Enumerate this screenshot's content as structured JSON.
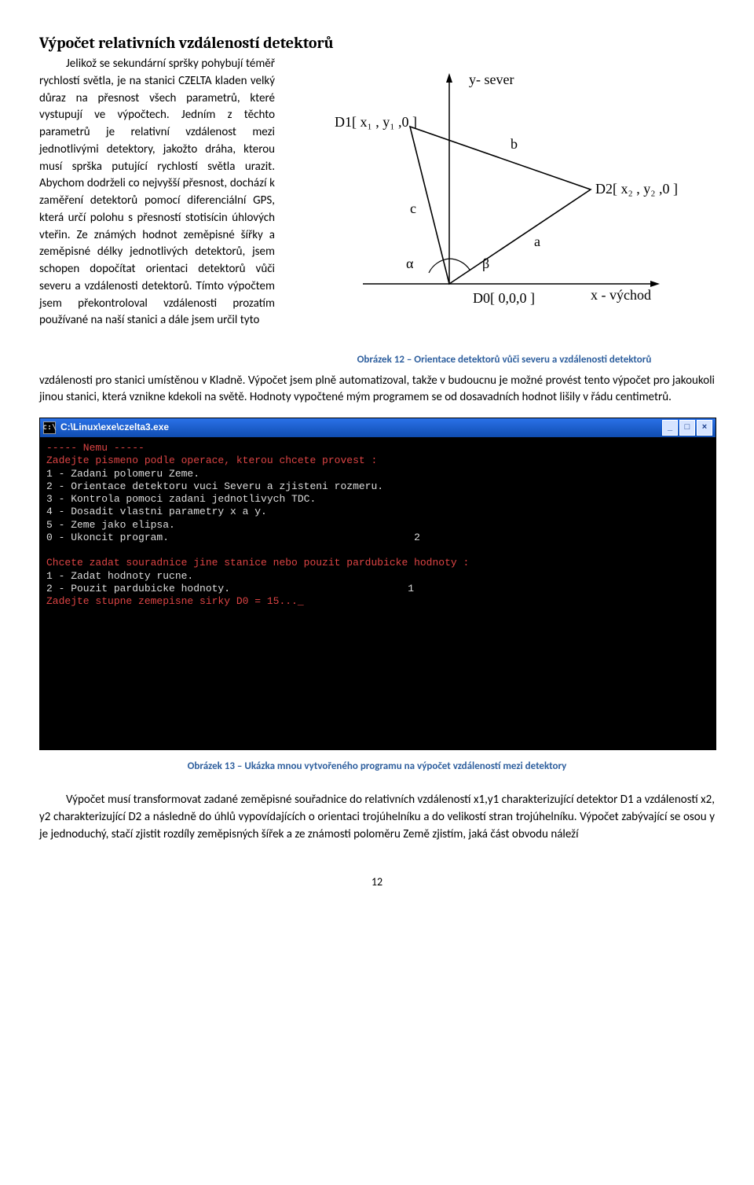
{
  "heading": "Výpočet relativních vzdáleností detektorů",
  "intro": "Jelikož se sekundární spršky pohybují téměř rychlostí světla, je na stanici CZELTA kladen velký důraz na přesnost všech parametrů, které vystupují ve výpočtech. Jedním z těchto parametrů je relativní vzdálenost mezi jednotlivými detektory, jakožto dráha, kterou musí sprška putující rychlostí světla urazit. Abychom dodrželi co nejvyšší přesnost, dochází k zaměření detektorů pomocí diferenciální GPS, která určí polohu s přesností stotisícin úhlových vteřin. Ze známých hodnot zeměpisné šířky a zeměpisné délky jednotlivých detektorů, jsem schopen dopočítat orientaci detektorů vůči severu a vzdálenosti detektorů. Tímto výpočtem jsem překontroloval vzdálenosti prozatím používané na naší stanici a dále jsem určil tyto",
  "after": "vzdálenosti pro stanici umístěnou v Kladně. Výpočet jsem plně automatizoval, takže v budoucnu je možné provést tento výpočet pro jakoukoli jinou stanici, která vznikne kdekoli na světě. Hodnoty vypočtené mým programem se od dosavadních hodnot lišily v řádu centimetrů.",
  "figure": {
    "ylabel": "y- sever",
    "xlabel": "x - východ",
    "D1": "D1[ x₁ , y₁ ,0 ]",
    "D2": "D2[ x₂ , y₂ ,0 ]",
    "D0": "D0[ 0,0,0 ]",
    "a": "a",
    "b": "b",
    "c": "c",
    "alpha": "α",
    "beta": "β",
    "caption": "Obrázek 12 – Orientace detektorů vůči severu a vzdálenosti detektorů"
  },
  "window": {
    "title": "C:\\Linux\\exe\\czelta3.exe",
    "min": "_",
    "max": "□",
    "close": "×"
  },
  "console": {
    "l01": "----- Nemu -----",
    "l02": "Zadejte pismeno podle operace, kterou chcete provest :",
    "l03": "1 - Zadani polomeru Zeme.",
    "l04": "2 - Orientace detektoru vuci Severu a zjisteni rozmeru.",
    "l05": "3 - Kontrola pomoci zadani jednotlivych TDC.",
    "l06": "4 - Dosadit vlastni parametry x a y.",
    "l07": "5 - Zeme jako elipsa.",
    "l08": "0 - Ukoncit program.",
    "inp1": "2",
    "l09": "Chcete zadat souradnice jine stanice nebo pouzit pardubicke hodnoty :",
    "l10": "1 - Zadat hodnoty rucne.",
    "l11": "2 - Pouzit pardubicke hodnoty.",
    "inp2": "1",
    "l12": "Zadejte stupne zemepisne sirky D0 = 15..._"
  },
  "caption2": "Obrázek 13 – Ukázka mnou vytvořeného programu na výpočet vzdáleností mezi detektory",
  "para2": "Výpočet musí transformovat zadané zeměpisné souřadnice do relativních vzdáleností x1,y1 charakterizující detektor D1 a vzdáleností x2, y2 charakterizující D2 a následně do úhlů vypovídajících o orientaci trojúhelníku a do velikostí stran trojúhelníku. Výpočet zabývající se osou y je jednoduchý, stačí zjistit rozdíly zeměpisných šířek a ze známosti poloměru Země zjistím, jaká část obvodu náleží",
  "page_num": "12"
}
